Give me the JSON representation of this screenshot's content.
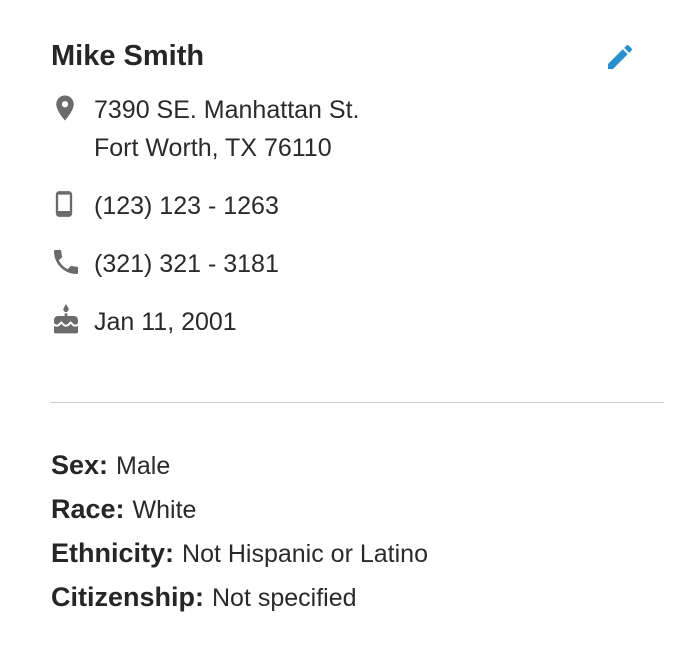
{
  "contact": {
    "name": "Mike Smith",
    "address_line1": "7390 SE. Manhattan St.",
    "address_line2": "Fort Worth, TX 76110",
    "mobile_phone": "(123) 123 - 1263",
    "home_phone": "(321) 321 - 3181",
    "birthdate": "Jan 11, 2001"
  },
  "demographics": [
    {
      "label": "Sex:",
      "value": "Male"
    },
    {
      "label": "Race:",
      "value": "White"
    },
    {
      "label": "Ethnicity:",
      "value": "Not Hispanic or Latino"
    },
    {
      "label": "Citizenship:",
      "value": "Not specified"
    }
  ],
  "icons": {
    "edit": "pencil-icon",
    "address": "map-pin-icon",
    "mobile": "mobile-phone-icon",
    "phone": "phone-icon",
    "birthday": "cake-icon"
  },
  "colors": {
    "accent": "#2a8fcf",
    "icon": "#6b6b6b",
    "text": "#2a2a2a",
    "divider": "#cfcfcf"
  }
}
